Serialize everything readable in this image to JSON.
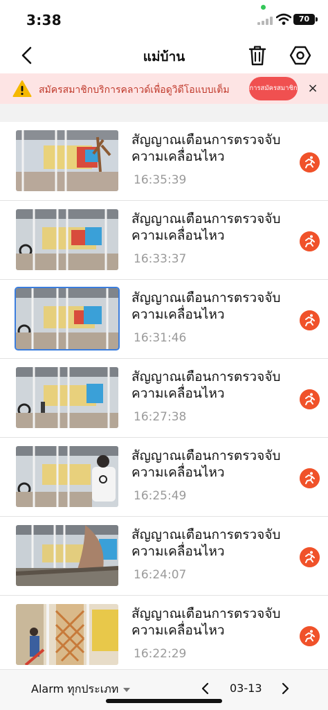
{
  "status_bar": {
    "time": "3:38",
    "battery": "70"
  },
  "header": {
    "title": "แม่บ้าน"
  },
  "banner": {
    "text": "สมัครสมาชิกบริการคลาวด์เพื่อดูวิดีโอแบบเต็ม",
    "button_label": "การสมัครสมาชิก",
    "close": "×"
  },
  "alarms": [
    {
      "title": "สัญญาณเตือนการตรวจจับความเคลื่อนไหว",
      "time": "16:35:39"
    },
    {
      "title": "สัญญาณเตือนการตรวจจับความเคลื่อนไหว",
      "time": "16:33:37"
    },
    {
      "title": "สัญญาณเตือนการตรวจจับความเคลื่อนไหว",
      "time": "16:31:46"
    },
    {
      "title": "สัญญาณเตือนการตรวจจับความเคลื่อนไหว",
      "time": "16:27:38"
    },
    {
      "title": "สัญญาณเตือนการตรวจจับความเคลื่อนไหว",
      "time": "16:25:49"
    },
    {
      "title": "สัญญาณเตือนการตรวจจับความเคลื่อนไหว",
      "time": "16:24:07"
    },
    {
      "title": "สัญญาณเตือนการตรวจจับความเคลื่อนไหว",
      "time": "16:22:29"
    }
  ],
  "bottom_bar": {
    "filter_label": "Alarm ทุกประเภท",
    "date": "03-13"
  },
  "colors": {
    "accent": "#f0522a",
    "banner_bg": "#fde4e4",
    "banner_text": "#c0392b",
    "subscribe_button": "#f05050",
    "selected_outline": "#3b7ddd"
  },
  "icons": [
    "back-chevron-icon",
    "trash-icon",
    "settings-hexagon-icon",
    "warning-triangle-icon",
    "close-icon",
    "running-person-icon",
    "caret-down-icon",
    "chevron-left-icon",
    "chevron-right-icon"
  ]
}
